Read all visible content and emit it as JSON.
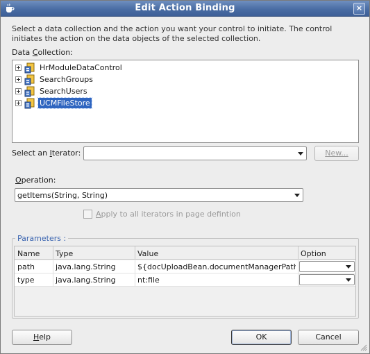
{
  "window": {
    "title": "Edit Action Binding",
    "close_label": "×"
  },
  "intro_text": "Select a data collection and the action you want your control to initiate. The control initiates the action on the data objects of the selected collection.",
  "data_collection": {
    "label_pre": "Data ",
    "label_mnemonic": "C",
    "label_post": "ollection:",
    "items": [
      {
        "label": "HrModuleDataControl",
        "selected": false
      },
      {
        "label": "SearchGroups",
        "selected": false
      },
      {
        "label": "SearchUsers",
        "selected": false
      },
      {
        "label": "UCMFileStore",
        "selected": true
      }
    ]
  },
  "iterator": {
    "label_pre": "Select an ",
    "label_mnemonic": "I",
    "label_post": "terator:",
    "value": "",
    "new_button": "New..."
  },
  "operation": {
    "label_mnemonic": "O",
    "label_post": "peration:",
    "value": "getItems(String, String)"
  },
  "apply_all": {
    "label_mnemonic": "A",
    "label_post": "pply to all iterators in page defintion",
    "checked": false
  },
  "parameters": {
    "legend": "Parameters :",
    "columns": [
      "Name",
      "Type",
      "Value",
      "Option"
    ],
    "rows": [
      {
        "name": "path",
        "type": "java.lang.String",
        "value": "${docUploadBean.documentManagerPath}",
        "option": ""
      },
      {
        "name": "type",
        "type": "java.lang.String",
        "value": "nt:file",
        "option": ""
      }
    ]
  },
  "buttons": {
    "help_mnemonic": "H",
    "help_post": "elp",
    "ok": "OK",
    "cancel": "Cancel"
  },
  "colors": {
    "title_bar": "#4a6da4",
    "selection": "#2f65c0",
    "legend_text": "#3a64b0",
    "dialog_bg": "#ededed"
  },
  "icons": {
    "window": "coffee-cup-icon",
    "tree_node": "data-control-icon",
    "expander": "plus-expander-icon"
  }
}
